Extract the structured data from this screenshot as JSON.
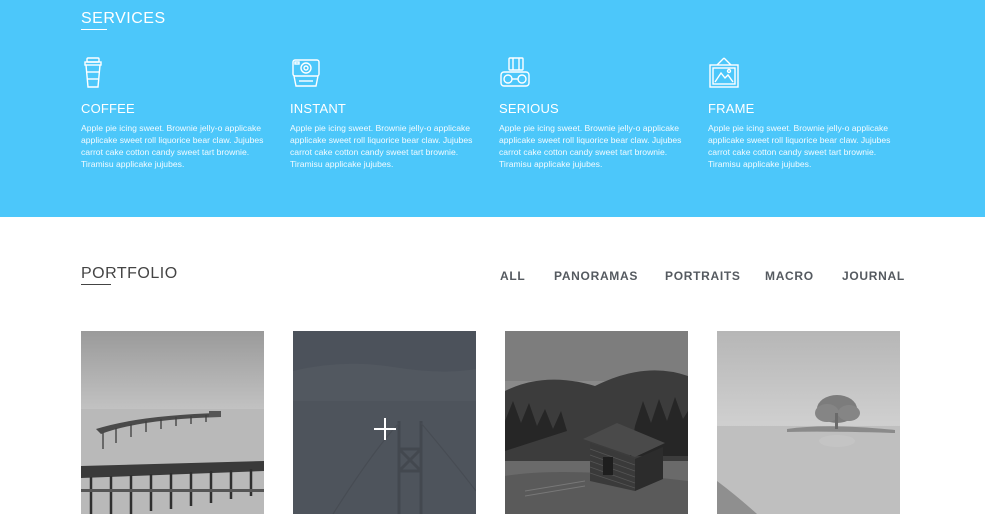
{
  "services": {
    "title": "SERVICES",
    "items": [
      {
        "name": "COFFEE",
        "icon": "coffee-cup-icon",
        "description": "Apple pie icing sweet. Brownie jelly-o applicake applicake sweet roll liquorice bear claw. Jujubes carrot cake cotton candy sweet tart brownie. Tiramisu applicake jujubes."
      },
      {
        "name": "INSTANT",
        "icon": "instant-camera-icon",
        "description": "Apple pie icing sweet. Brownie jelly-o applicake applicake sweet roll liquorice bear claw. Jujubes carrot cake cotton candy sweet tart brownie. Tiramisu applicake jujubes."
      },
      {
        "name": "SERIOUS",
        "icon": "film-camera-icon",
        "description": "Apple pie icing sweet. Brownie jelly-o applicake applicake sweet roll liquorice bear claw. Jujubes carrot cake cotton candy sweet tart brownie. Tiramisu applicake jujubes."
      },
      {
        "name": "FRAME",
        "icon": "picture-frame-icon",
        "description": "Apple pie icing sweet. Brownie jelly-o applicake applicake sweet roll liquorice bear claw. Jujubes carrot cake cotton candy sweet tart brownie. Tiramisu applicake jujubes."
      }
    ]
  },
  "portfolio": {
    "title": "PORTFOLIO",
    "filters": [
      "ALL",
      "PANORAMAS",
      "PORTRAITS",
      "MACRO",
      "JOURNAL"
    ],
    "thumbnails": [
      {
        "subject": "pier-photo"
      },
      {
        "subject": "golden-gate-bridge-photo",
        "hovered": true,
        "overlay_icon": "plus-icon"
      },
      {
        "subject": "cabin-in-forest-photo"
      },
      {
        "subject": "island-tree-photo"
      }
    ]
  },
  "colors": {
    "services_bg": "#4cc7fa",
    "text_dark": "#444444",
    "filter_text": "#555a60",
    "hover_overlay": "#4a5059"
  }
}
